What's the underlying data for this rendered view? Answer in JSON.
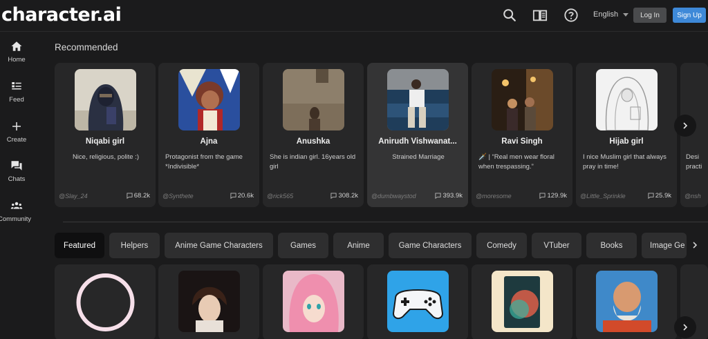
{
  "header": {
    "logo": "character.ai",
    "language": "English",
    "login_label": "Log In",
    "signup_label": "Sign Up",
    "icons": [
      "search-icon",
      "book-icon",
      "help-icon"
    ]
  },
  "sidebar": {
    "items": [
      {
        "label": "Home",
        "icon": "home-icon"
      },
      {
        "label": "Feed",
        "icon": "feed-icon"
      },
      {
        "label": "Create",
        "icon": "plus-icon"
      },
      {
        "label": "Chats",
        "icon": "chat-icon"
      },
      {
        "label": "Community",
        "icon": "community-icon"
      }
    ]
  },
  "recommended": {
    "title": "Recommended",
    "cards": [
      {
        "name": "Niqabi girl",
        "description": "Nice, religious, polite :)",
        "author": "@Slay_24",
        "count": "68.2k"
      },
      {
        "name": "Ajna",
        "description": "Protagonist from the game *Indivisible*",
        "author": "@Synthete",
        "count": "20.6k"
      },
      {
        "name": "Anushka",
        "description": "She is indian girl. 16years old girl",
        "author": "@rick565",
        "count": "308.2k"
      },
      {
        "name": "Anirudh Vishwanat...",
        "description": "Strained Marriage",
        "author": "@dumbwaystod",
        "count": "393.9k"
      },
      {
        "name": "Ravi Singh",
        "description": "🗡️ | “Real men wear floral when trespassing.”",
        "author": "@moresome",
        "count": "129.9k"
      },
      {
        "name": "Hijab girl",
        "description": "I nice Muslim girl that always pray in time!",
        "author": "@Little_Sprinkle",
        "count": "25.9k"
      },
      {
        "name": "",
        "description": "Desi practi",
        "author": "@nsh",
        "count": ""
      }
    ]
  },
  "categories": {
    "chips": [
      "Featured",
      "Helpers",
      "Anime Game Characters",
      "Games",
      "Anime",
      "Game Characters",
      "Comedy",
      "VTuber",
      "Books",
      "Image Ge"
    ]
  },
  "colors": {
    "background": "#1b1b1c",
    "card": "#272728",
    "accent": "#3e89d8"
  }
}
